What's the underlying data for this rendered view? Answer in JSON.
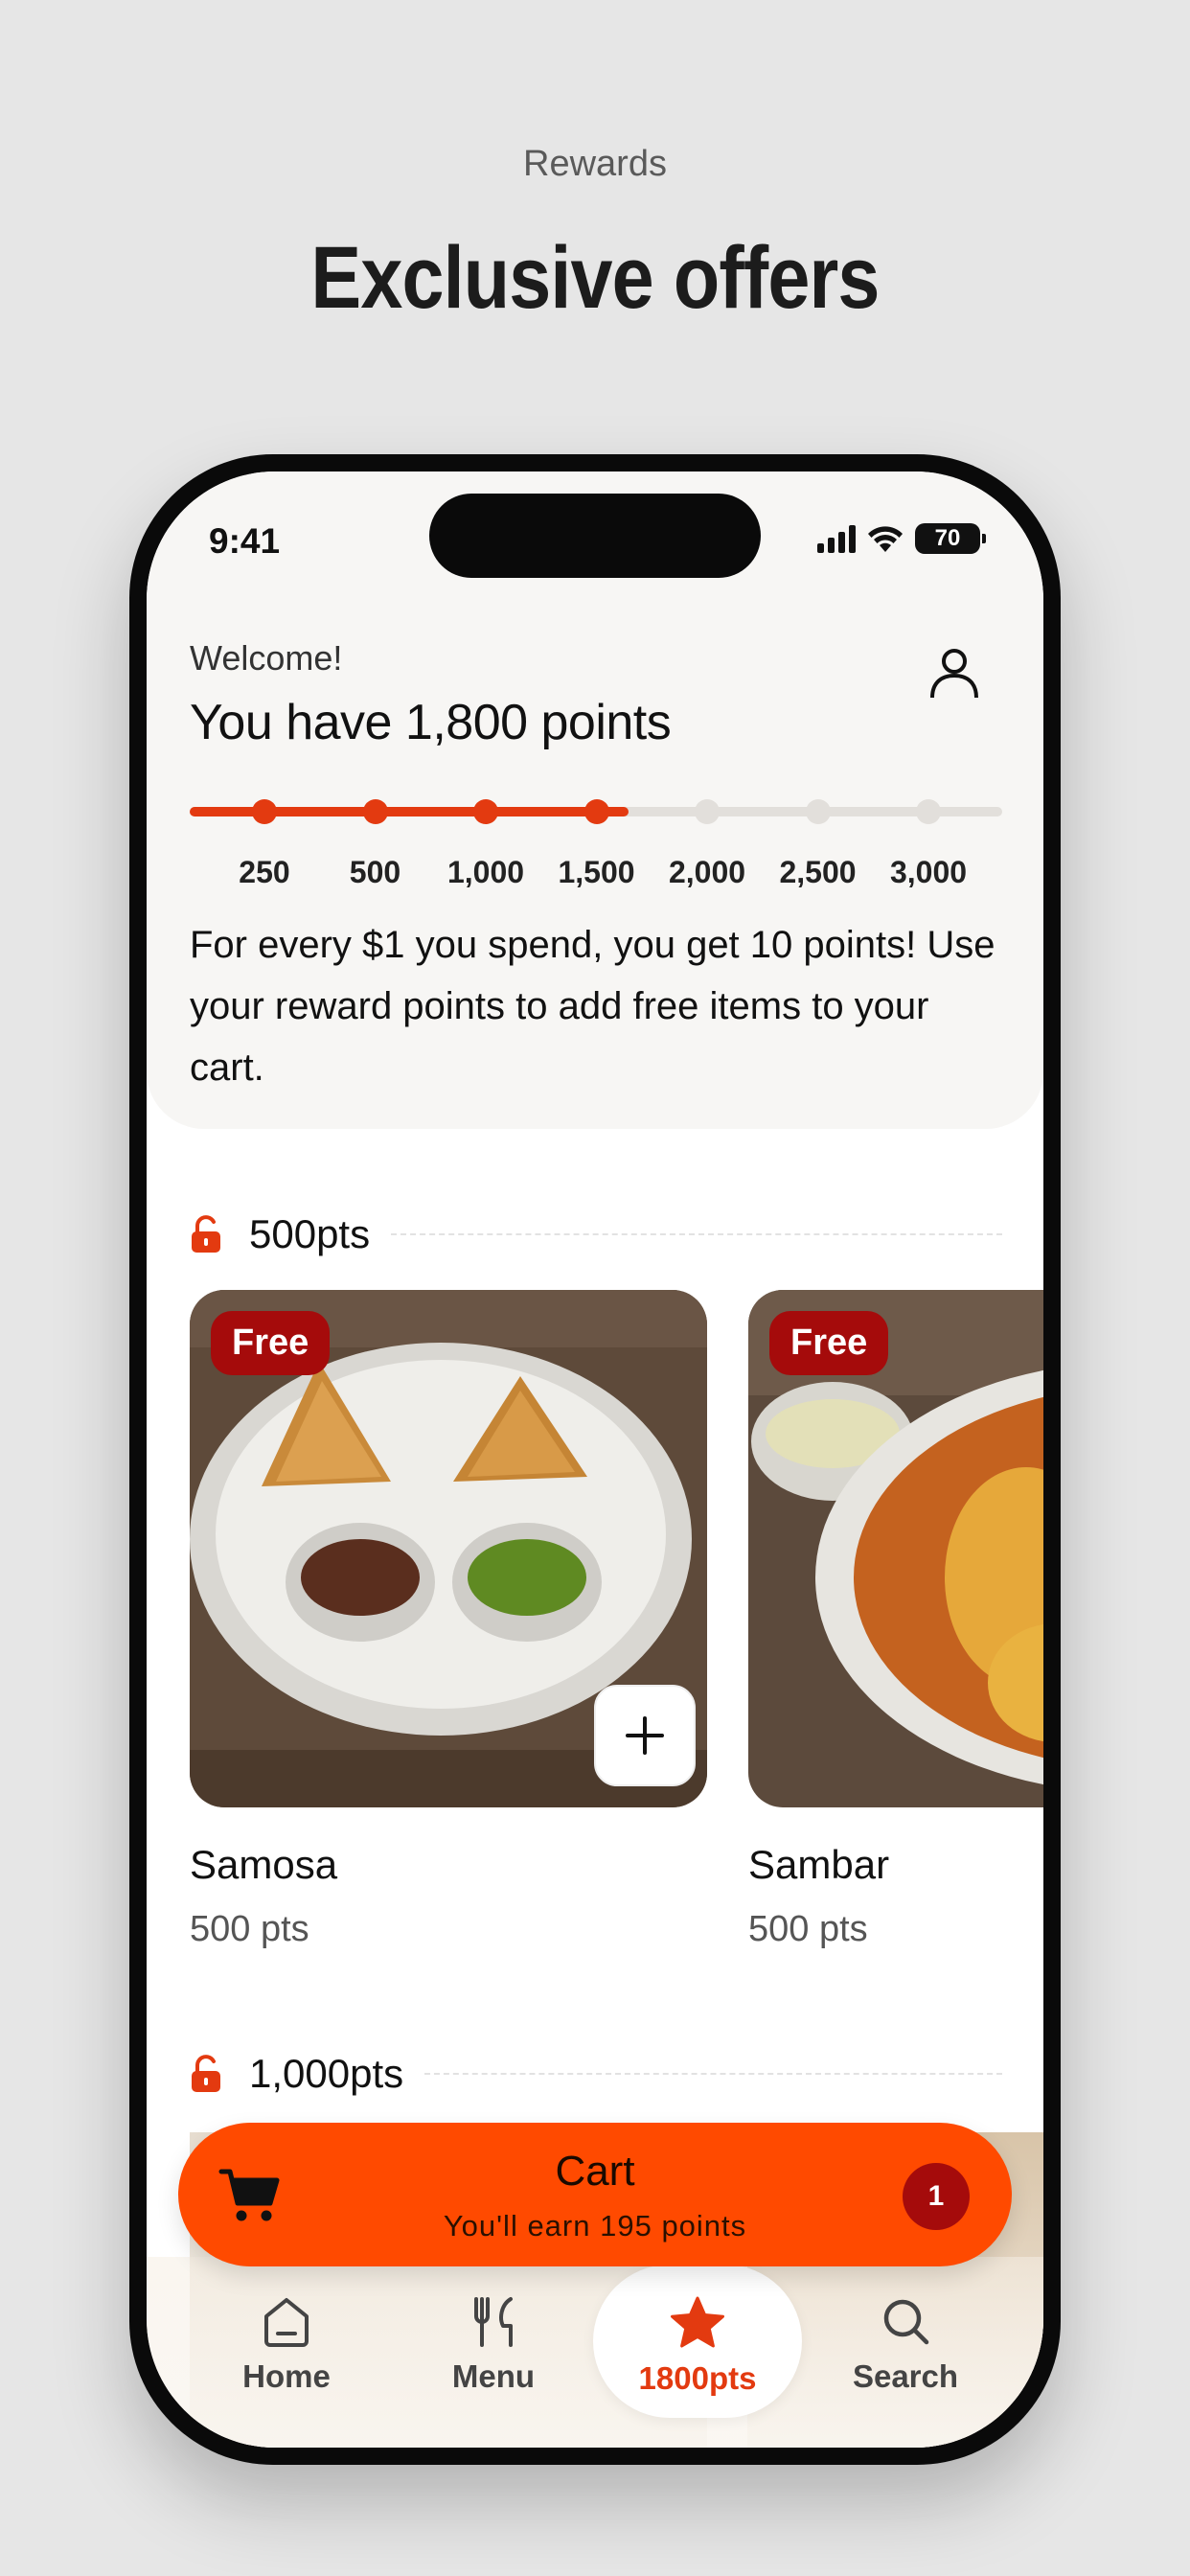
{
  "page": {
    "eyebrow": "Rewards",
    "title": "Exclusive offers"
  },
  "status_bar": {
    "time": "9:41",
    "battery": "70"
  },
  "header": {
    "welcome": "Welcome!",
    "points_heading": "You have 1,800 points",
    "progress": {
      "current_points": 1800,
      "milestones": [
        "250",
        "500",
        "1,000",
        "1,500",
        "2,000",
        "2,500",
        "3,000"
      ],
      "reached_count": 4,
      "fill_fraction": 0.54
    },
    "info_text": "For every $1 you spend, you get 10 points! Use your reward points to add free items to your cart."
  },
  "tiers": [
    {
      "label": "500pts"
    },
    {
      "label": "1,000pts"
    }
  ],
  "products": [
    {
      "badge": "Free",
      "name": "Samosa",
      "points": "500 pts"
    },
    {
      "badge": "Free",
      "name": "Sambar",
      "points": "500 pts"
    }
  ],
  "cart": {
    "title": "Cart",
    "subtitle": "You'll earn 195 points",
    "count": "1"
  },
  "tab_bar": {
    "items": [
      {
        "label": "Home",
        "icon": "home-icon"
      },
      {
        "label": "Menu",
        "icon": "utensils-icon"
      },
      {
        "label": "1800pts",
        "icon": "star-icon"
      },
      {
        "label": "Search",
        "icon": "search-icon"
      }
    ],
    "active_index": 2
  },
  "colors": {
    "accent": "#e33a10",
    "cart_orange": "#ff4a00",
    "badge_red": "#a50b0b",
    "background": "#e6e6e6"
  }
}
